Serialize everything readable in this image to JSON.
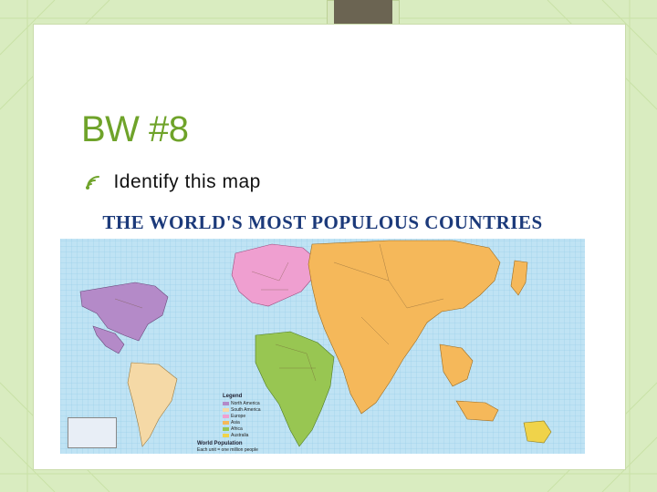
{
  "slide": {
    "title": "BW #8",
    "bullet": {
      "icon": "signal-bullet-icon",
      "text": "Identify this map"
    }
  },
  "map": {
    "title": "THE WORLD'S MOST POPULOUS COUNTRIES",
    "legend": {
      "title": "Legend",
      "items": [
        {
          "label": "North America",
          "color": "#b48ac8"
        },
        {
          "label": "South America",
          "color": "#f5d9a6"
        },
        {
          "label": "Europe",
          "color": "#ef9fd0"
        },
        {
          "label": "Asia",
          "color": "#f5b85a"
        },
        {
          "label": "Africa",
          "color": "#98c652"
        },
        {
          "label": "Australia",
          "color": "#f0d34a"
        }
      ]
    },
    "population_note": {
      "title": "World Population",
      "lines": [
        "Each unit = one million people"
      ]
    }
  },
  "colors": {
    "accent": "#6fa32a",
    "ocean": "#bfe3f4",
    "grid": "#8fc7e6"
  }
}
